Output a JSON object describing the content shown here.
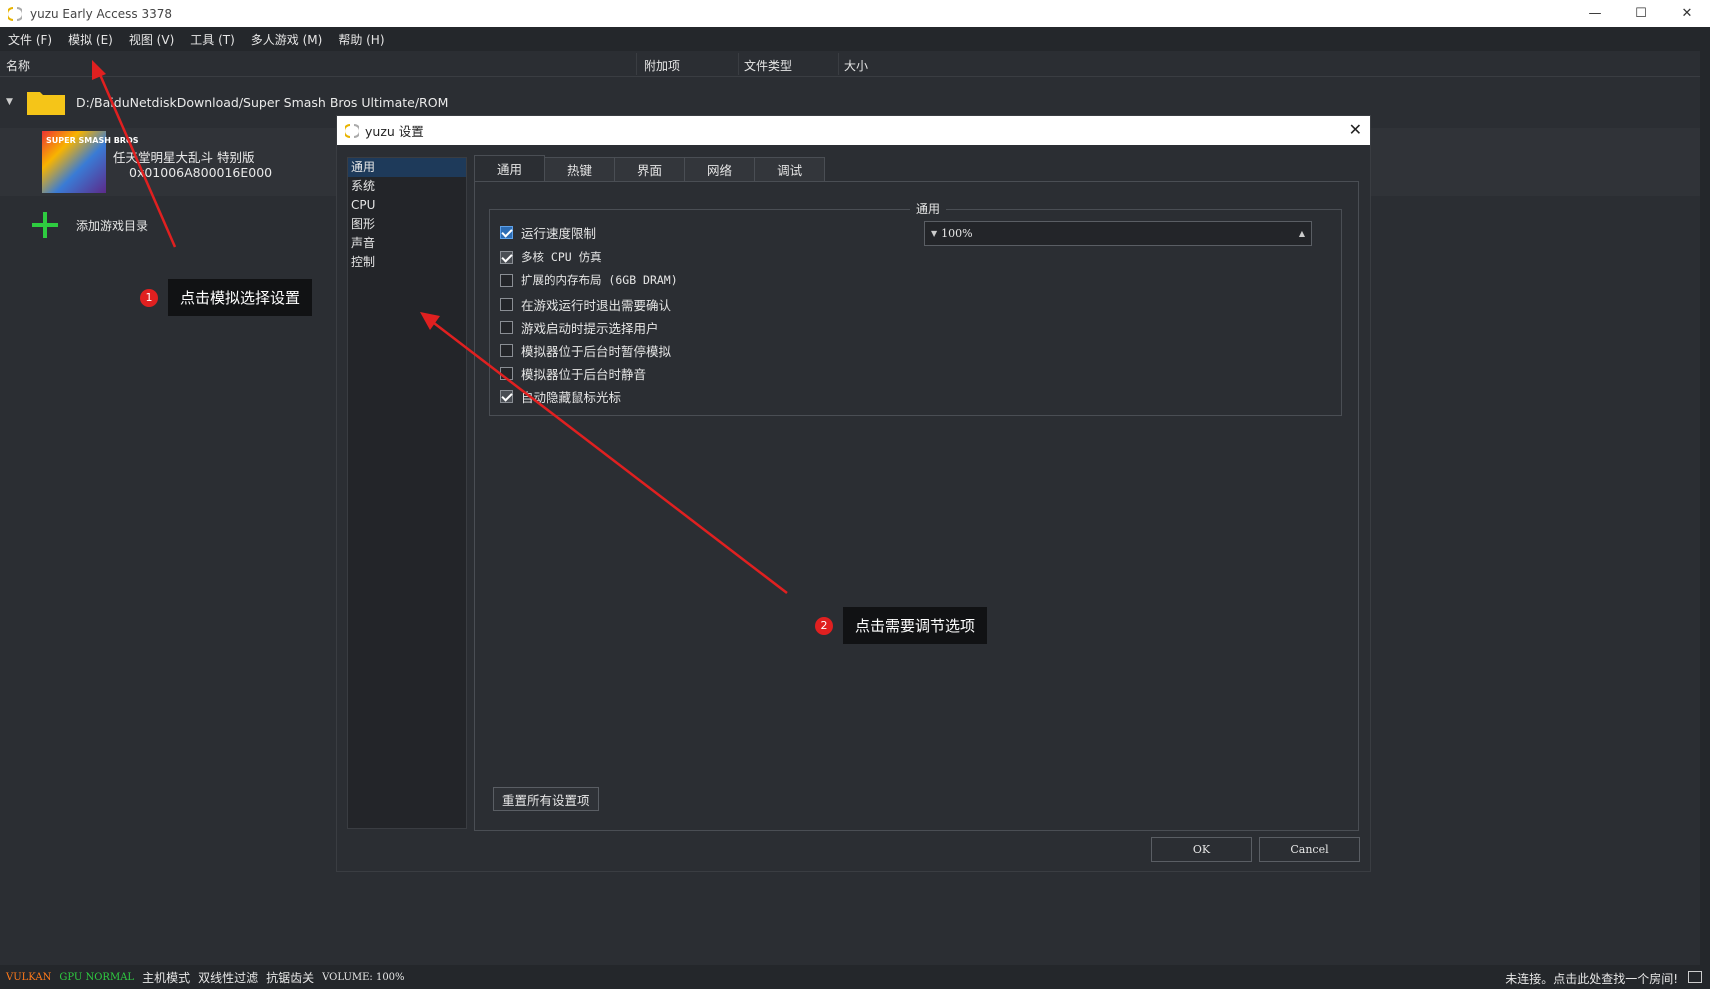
{
  "window": {
    "title": "yuzu Early Access 3378",
    "controls": {
      "minimize": "—",
      "maximize": "☐",
      "close": "✕"
    }
  },
  "menubar": {
    "items": [
      "文件 (F)",
      "模拟 (E)",
      "视图 (V)",
      "工具 (T)",
      "多人游戏 (M)",
      "帮助 (H)"
    ]
  },
  "gamelist": {
    "columns": {
      "name": "名称",
      "addons": "附加项",
      "filetype": "文件类型",
      "size": "大小"
    },
    "folder_path": "D:/BaiduNetdiskDownload/Super Smash Bros Ultimate/ROM",
    "game": {
      "title": "任天堂明星大乱斗 特别版",
      "id": "0x01006A800016E000",
      "thumb_text": "SUPER SMASH BROS"
    },
    "add_dir_label": "添加游戏目录"
  },
  "annotations": [
    {
      "num": "1",
      "text": "点击模拟选择设置"
    },
    {
      "num": "2",
      "text": "点击需要调节选项"
    }
  ],
  "dialog": {
    "title": "yuzu 设置",
    "close": "✕",
    "categories": [
      "通用",
      "系统",
      "CPU",
      "图形",
      "声音",
      "控制"
    ],
    "tabs": [
      "通用",
      "热键",
      "界面",
      "网络",
      "调试"
    ],
    "group_title": "通用",
    "options": [
      {
        "label": "运行速度限制",
        "checked": true
      },
      {
        "label": "多核 CPU 仿真",
        "checked": true
      },
      {
        "label": "扩展的内存布局 (6GB DRAM)",
        "checked": false
      },
      {
        "label": "在游戏运行时退出需要确认",
        "checked": false
      },
      {
        "label": "游戏启动时提示选择用户",
        "checked": false
      },
      {
        "label": "模拟器位于后台时暂停模拟",
        "checked": false
      },
      {
        "label": "模拟器位于后台时静音",
        "checked": false
      },
      {
        "label": "自动隐藏鼠标光标",
        "checked": true
      }
    ],
    "speed_value": "100%",
    "reset_label": "重置所有设置项",
    "ok_label": "OK",
    "cancel_label": "Cancel"
  },
  "statusbar": {
    "vulkan": "VULKAN",
    "gpu": "GPU NORMAL",
    "mode": "主机模式",
    "filter": "双线性过滤",
    "aa": "抗锯齿关",
    "volume": "VOLUME: 100%",
    "right": "未连接。点击此处查找一个房间!"
  },
  "colors": {
    "accent": "#2d6db5",
    "annotation_red": "#e02020",
    "vulkan": "#ff7a1a",
    "gpu_ok": "#2ecc40",
    "folder": "#f5c518"
  }
}
